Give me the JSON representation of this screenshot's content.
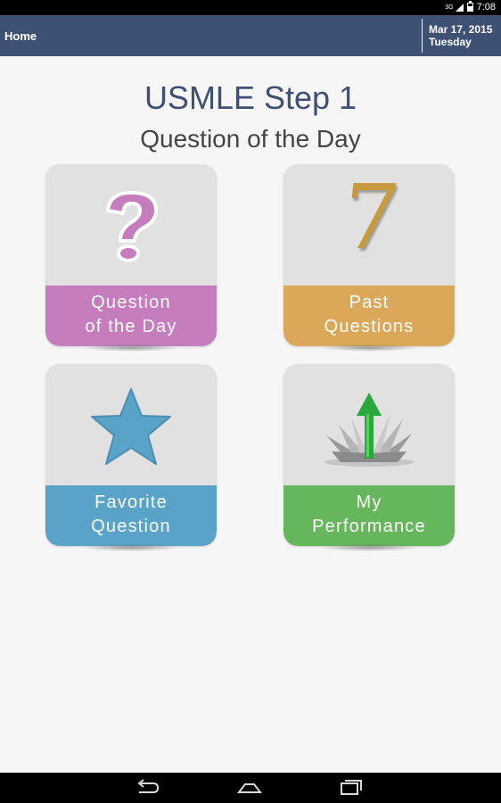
{
  "status_bar": {
    "network": "3G",
    "time": "7:08"
  },
  "action_bar": {
    "home_label": "Home",
    "date_line1": "Mar 17, 2015",
    "date_line2": "Tuesday"
  },
  "header": {
    "title": "USMLE Step 1",
    "subtitle": "Question of the Day"
  },
  "tiles": [
    {
      "line1": "Question",
      "line2": "of the Day",
      "icon": "question-mark-icon",
      "color": "#c57dbd"
    },
    {
      "line1": "Past",
      "line2": "Questions",
      "icon": "number-seven-icon",
      "glyph": "7",
      "color": "#dba85a"
    },
    {
      "line1": "Favorite",
      "line2": "Question",
      "icon": "star-icon",
      "color": "#5aa3c8"
    },
    {
      "line1": "My",
      "line2": "Performance",
      "icon": "growth-arrow-icon",
      "color": "#66b65b"
    }
  ],
  "nav_bar": {
    "buttons": [
      "back-icon",
      "home-icon",
      "recent-apps-icon"
    ]
  }
}
